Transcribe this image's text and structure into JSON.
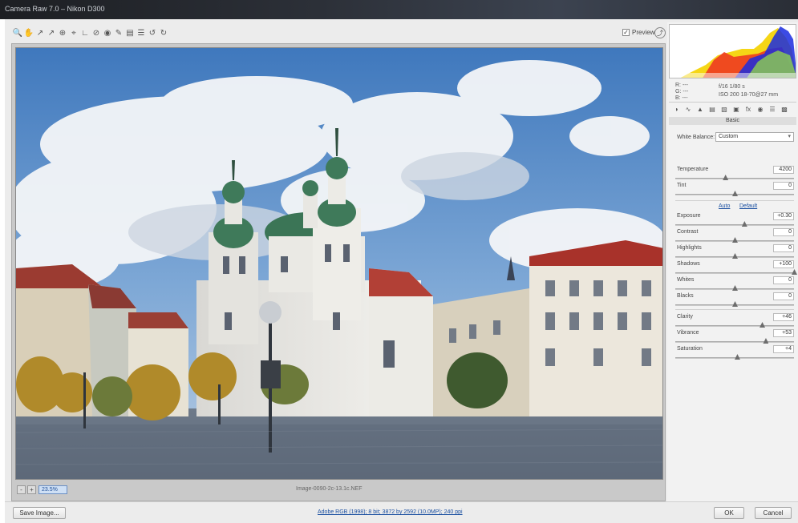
{
  "window": {
    "title": "Camera Raw 7.0 – Nikon D300"
  },
  "toolbar": {
    "tools": [
      "zoom-tool",
      "hand-tool",
      "white-balance-tool",
      "color-sampler-tool",
      "targeted-adjustment-tool",
      "crop-tool",
      "straighten-tool",
      "spot-removal-tool",
      "red-eye-tool",
      "adjustment-brush-tool",
      "graduated-filter-tool",
      "preferences-tool",
      "rotate-ccw-tool",
      "rotate-cw-tool"
    ],
    "preview_label": "Preview",
    "preview_checked": true
  },
  "preview": {
    "zoom": "23.5%",
    "zoom_minus": "-",
    "zoom_plus": "+",
    "image_name": "Image-0090-2c-13.1c.NEF"
  },
  "histogram": {
    "rgb_labels": [
      "R: ---",
      "G: ---",
      "B: ---"
    ],
    "camera_info": [
      "f/16   1/80 s",
      "ISO 200   18-70@27 mm"
    ]
  },
  "panel": {
    "tabs": [
      "basic",
      "tone-curve",
      "detail",
      "hsl",
      "split-toning",
      "lens-corrections",
      "effects",
      "camera-calibration",
      "presets",
      "snapshots"
    ],
    "name": "Basic",
    "white_balance_label": "White Balance:",
    "white_balance_value": "Custom",
    "auto_label": "Auto",
    "default_label": "Default",
    "sliders": [
      {
        "key": "temperature",
        "label": "Temperature",
        "value": "4200",
        "pos": 0.42
      },
      {
        "key": "tint",
        "label": "Tint",
        "value": "0",
        "pos": 0.5
      },
      {
        "key": "exposure",
        "label": "Exposure",
        "value": "+0.30",
        "pos": 0.58
      },
      {
        "key": "contrast",
        "label": "Contrast",
        "value": "0",
        "pos": 0.5
      },
      {
        "key": "highlights",
        "label": "Highlights",
        "value": "0",
        "pos": 0.5
      },
      {
        "key": "shadows",
        "label": "Shadows",
        "value": "+100",
        "pos": 1.0
      },
      {
        "key": "whites",
        "label": "Whites",
        "value": "0",
        "pos": 0.5
      },
      {
        "key": "blacks",
        "label": "Blacks",
        "value": "0",
        "pos": 0.5
      },
      {
        "key": "clarity",
        "label": "Clarity",
        "value": "+46",
        "pos": 0.73
      },
      {
        "key": "vibrance",
        "label": "Vibrance",
        "value": "+53",
        "pos": 0.76
      },
      {
        "key": "saturation",
        "label": "Saturation",
        "value": "+4",
        "pos": 0.52
      }
    ]
  },
  "bottom": {
    "save_label": "Save Image...",
    "workflow_link": "Adobe RGB (1998); 8 bit; 3872 by 2592 (10.0MP); 240 ppi",
    "ok_label": "OK",
    "cancel_label": "Cancel"
  },
  "colors": {
    "accent": "#1a4fa0",
    "sky": "#4f86c6",
    "roof_red": "#a8322a",
    "dome_green": "#3f7a5a"
  }
}
